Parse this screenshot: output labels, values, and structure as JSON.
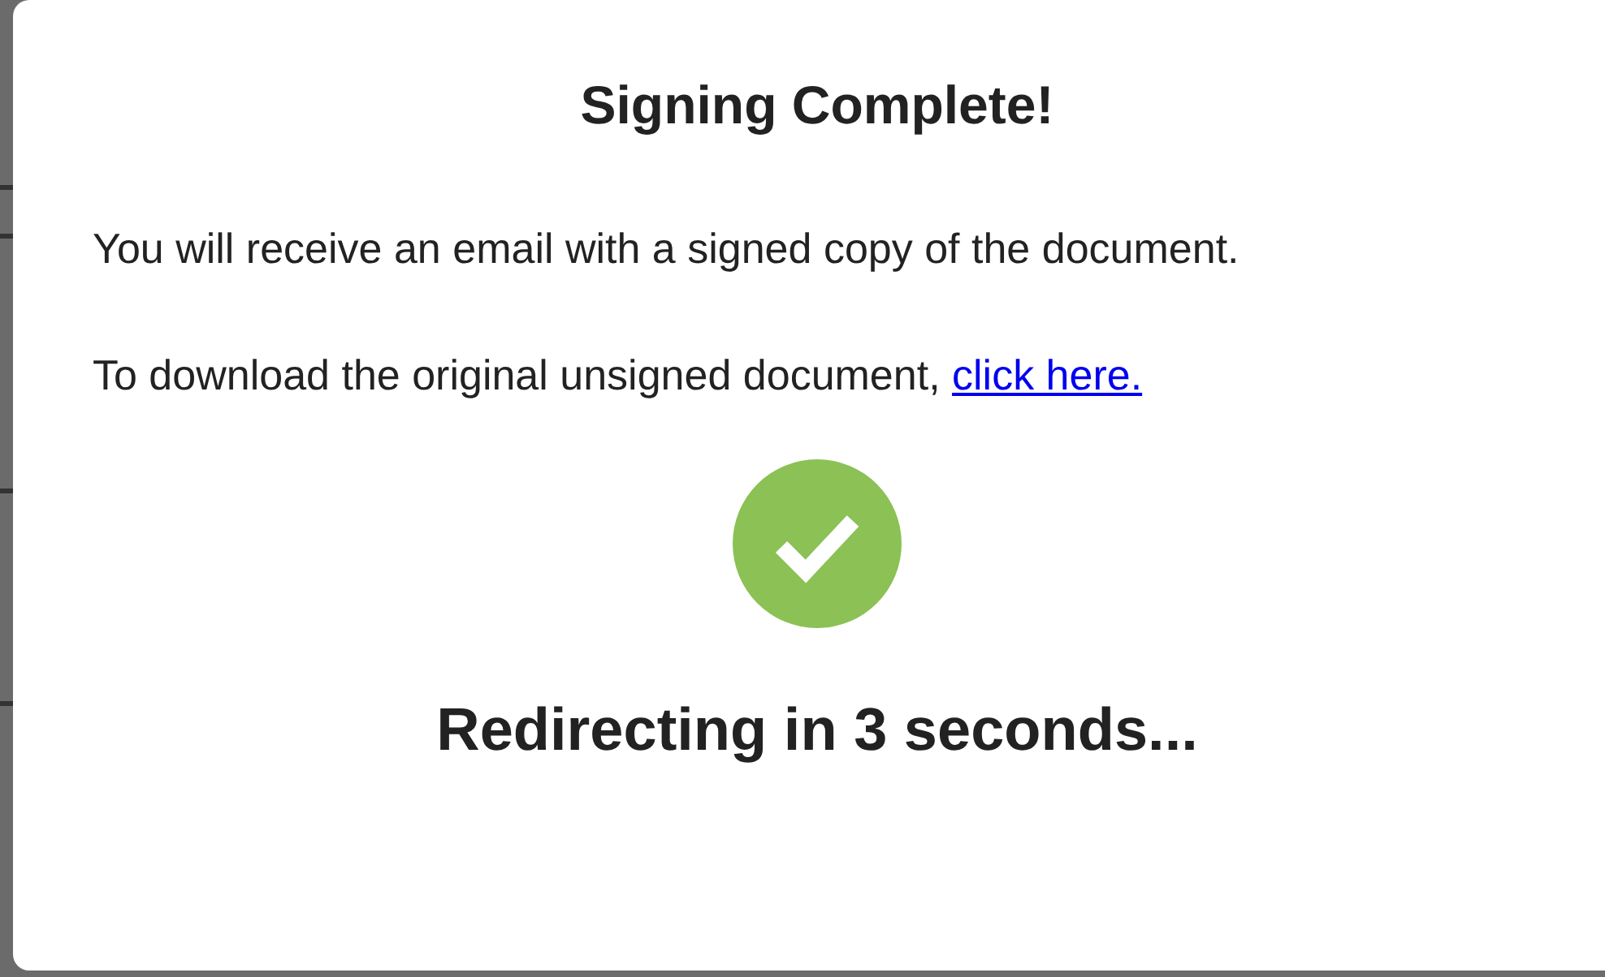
{
  "dialog": {
    "title": "Signing Complete!",
    "message": "You will receive an email with a signed copy of the document.",
    "download_text": "To download the original unsigned document, ",
    "download_link": "click here.",
    "status": "Redirecting in 3 seconds..."
  }
}
